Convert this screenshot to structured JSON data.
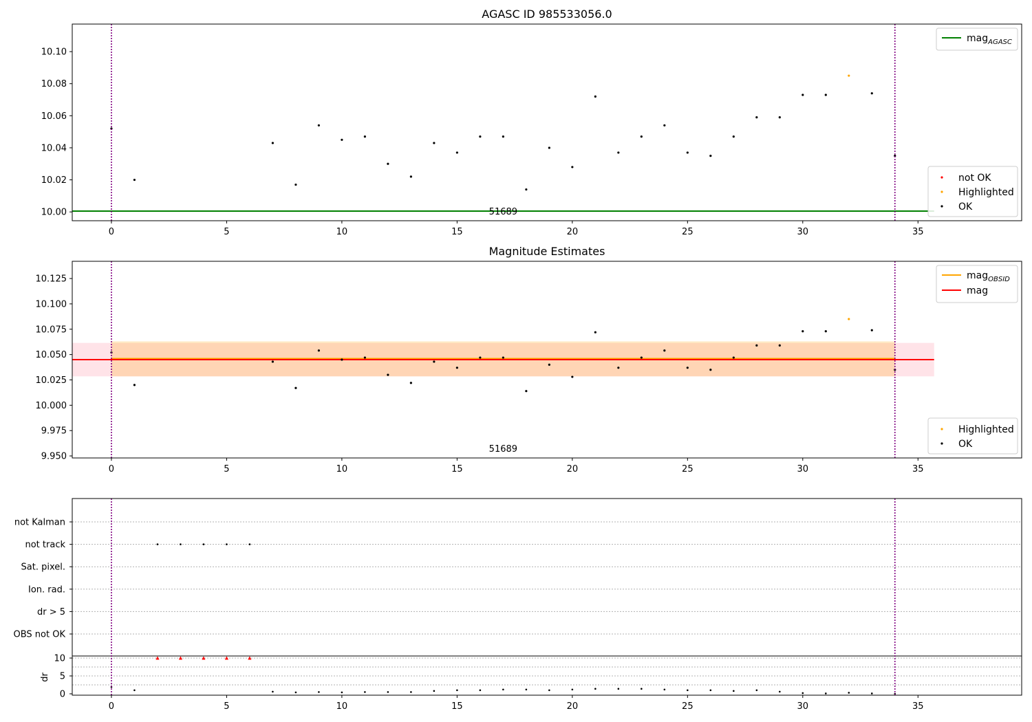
{
  "chart_data": [
    {
      "type": "scatter",
      "title": "AGASC ID 985533056.0",
      "xlim": [
        -1.7,
        39.5
      ],
      "ylim": [
        9.9945,
        10.1172
      ],
      "xticks": [
        0,
        5,
        10,
        15,
        20,
        25,
        30,
        35
      ],
      "yticks": [
        "10.00",
        "10.02",
        "10.04",
        "10.06",
        "10.08",
        "10.10"
      ],
      "annotation": "51689",
      "annotation_x": 17,
      "vlines": [
        0,
        34
      ],
      "vline_color": "#800080",
      "hlines": [
        {
          "name": "mag_AGASC",
          "y": 10.0005,
          "x": [
            -1.7,
            35.7
          ],
          "color": "#008000"
        }
      ],
      "legend_lines": [
        {
          "label": "mag",
          "sub": "AGASC",
          "color": "#008000"
        }
      ],
      "legend_points": [
        {
          "label": "not OK",
          "color": "#ff0000"
        },
        {
          "label": "Highlighted",
          "color": "#ffa500"
        },
        {
          "label": "OK",
          "color": "#000000"
        }
      ],
      "series": [
        {
          "name": "OK",
          "color": "#000000",
          "x": [
            0,
            1,
            7,
            8,
            9,
            10,
            11,
            12,
            13,
            14,
            15,
            16,
            17,
            18,
            19,
            20,
            21,
            22,
            23,
            24,
            25,
            26,
            27,
            28,
            29,
            30,
            31,
            33,
            34
          ],
          "y": [
            10.052,
            10.02,
            10.043,
            10.017,
            10.054,
            10.045,
            10.047,
            10.03,
            10.022,
            10.043,
            10.037,
            10.047,
            10.047,
            10.014,
            10.04,
            10.028,
            10.072,
            10.037,
            10.047,
            10.054,
            10.037,
            10.035,
            10.047,
            10.059,
            10.059,
            10.073,
            10.073,
            10.074,
            10.035
          ]
        },
        {
          "name": "Highlighted",
          "color": "#ffa500",
          "x": [
            32
          ],
          "y": [
            10.085
          ]
        }
      ]
    },
    {
      "type": "scatter",
      "title": "Magnitude Estimates",
      "xlim": [
        -1.7,
        39.5
      ],
      "ylim": [
        9.948,
        10.142
      ],
      "xticks": [
        0,
        5,
        10,
        15,
        20,
        25,
        30,
        35
      ],
      "yticks": [
        "9.950",
        "9.975",
        "10.000",
        "10.025",
        "10.050",
        "10.075",
        "10.100",
        "10.125"
      ],
      "annotation": "51689",
      "annotation_x": 17,
      "vlines": [
        0,
        34
      ],
      "vline_color": "#800080",
      "bands": [
        {
          "name": "mag",
          "x": [
            -1.7,
            35.7
          ],
          "y": [
            10.0285,
            10.0615
          ],
          "color": "#ffc0cb",
          "opacity": 0.45
        },
        {
          "name": "mag_OBSID",
          "x": [
            0,
            34
          ],
          "y": [
            10.0285,
            10.063
          ],
          "color": "#ffa500",
          "opacity": 0.22
        }
      ],
      "hlines": [
        {
          "name": "mag_OBSID",
          "y": 10.046,
          "x": [
            0,
            34
          ],
          "color": "#ffa500"
        },
        {
          "name": "mag",
          "y": 10.045,
          "x": [
            -1.7,
            35.7
          ],
          "color": "#ff0000"
        }
      ],
      "legend_lines": [
        {
          "label": "mag",
          "sub": "OBSID",
          "color": "#ffa500"
        },
        {
          "label": "mag",
          "sub": "",
          "color": "#ff0000"
        }
      ],
      "legend_points": [
        {
          "label": "Highlighted",
          "color": "#ffa500"
        },
        {
          "label": "OK",
          "color": "#000000"
        }
      ],
      "series": [
        {
          "name": "OK",
          "color": "#000000",
          "x": [
            0,
            1,
            7,
            8,
            9,
            10,
            11,
            12,
            13,
            14,
            15,
            16,
            17,
            18,
            19,
            20,
            21,
            22,
            23,
            24,
            25,
            26,
            27,
            28,
            29,
            30,
            31,
            33,
            34
          ],
          "y": [
            10.052,
            10.02,
            10.043,
            10.017,
            10.054,
            10.045,
            10.047,
            10.03,
            10.022,
            10.043,
            10.037,
            10.047,
            10.047,
            10.014,
            10.04,
            10.028,
            10.072,
            10.037,
            10.047,
            10.054,
            10.037,
            10.035,
            10.047,
            10.059,
            10.059,
            10.073,
            10.073,
            10.074,
            10.035
          ]
        },
        {
          "name": "Highlighted",
          "color": "#ffa500",
          "x": [
            32
          ],
          "y": [
            10.085
          ]
        }
      ]
    },
    {
      "type": "scatter",
      "title": "",
      "xlim": [
        -1.7,
        39.5
      ],
      "xticks": [
        0,
        5,
        10,
        15,
        20,
        25,
        30,
        35
      ],
      "vlines": [
        0,
        34
      ],
      "vline_color": "#800080",
      "flag_categories": [
        "not Kalman",
        "not track",
        "Sat. pixel.",
        "Ion. rad.",
        "dr > 5",
        "OBS not OK"
      ],
      "flags": [
        {
          "category": "not track",
          "x": [
            2,
            3,
            4,
            5,
            6
          ],
          "color": "#000000"
        }
      ],
      "dr_ylabel": "dr",
      "dr_ylim": [
        0,
        10
      ],
      "dr_yticks": [
        "0",
        "5",
        "10"
      ],
      "dr_points": [
        {
          "x": [
            0,
            1,
            7,
            8,
            9,
            10,
            11,
            12,
            13,
            14,
            15,
            16,
            17,
            18,
            19,
            20,
            21,
            22,
            23,
            24,
            25,
            26,
            27,
            28,
            29,
            30,
            31,
            32,
            33,
            34
          ],
          "y": [
            1.9,
            1.0,
            0.6,
            0.4,
            0.5,
            0.4,
            0.5,
            0.5,
            0.5,
            0.8,
            1.0,
            1.0,
            1.2,
            1.2,
            1.0,
            1.2,
            1.4,
            1.4,
            1.4,
            1.2,
            1.0,
            1.0,
            0.8,
            1.0,
            0.6,
            0.2,
            0.1,
            0.3,
            0.1,
            0.0
          ],
          "color": "#000000",
          "marker": "dot"
        },
        {
          "x": [
            2,
            3,
            4,
            5,
            6
          ],
          "y": [
            10,
            10,
            10,
            10,
            10
          ],
          "color": "#ff0000",
          "marker": "triangle"
        }
      ]
    }
  ]
}
